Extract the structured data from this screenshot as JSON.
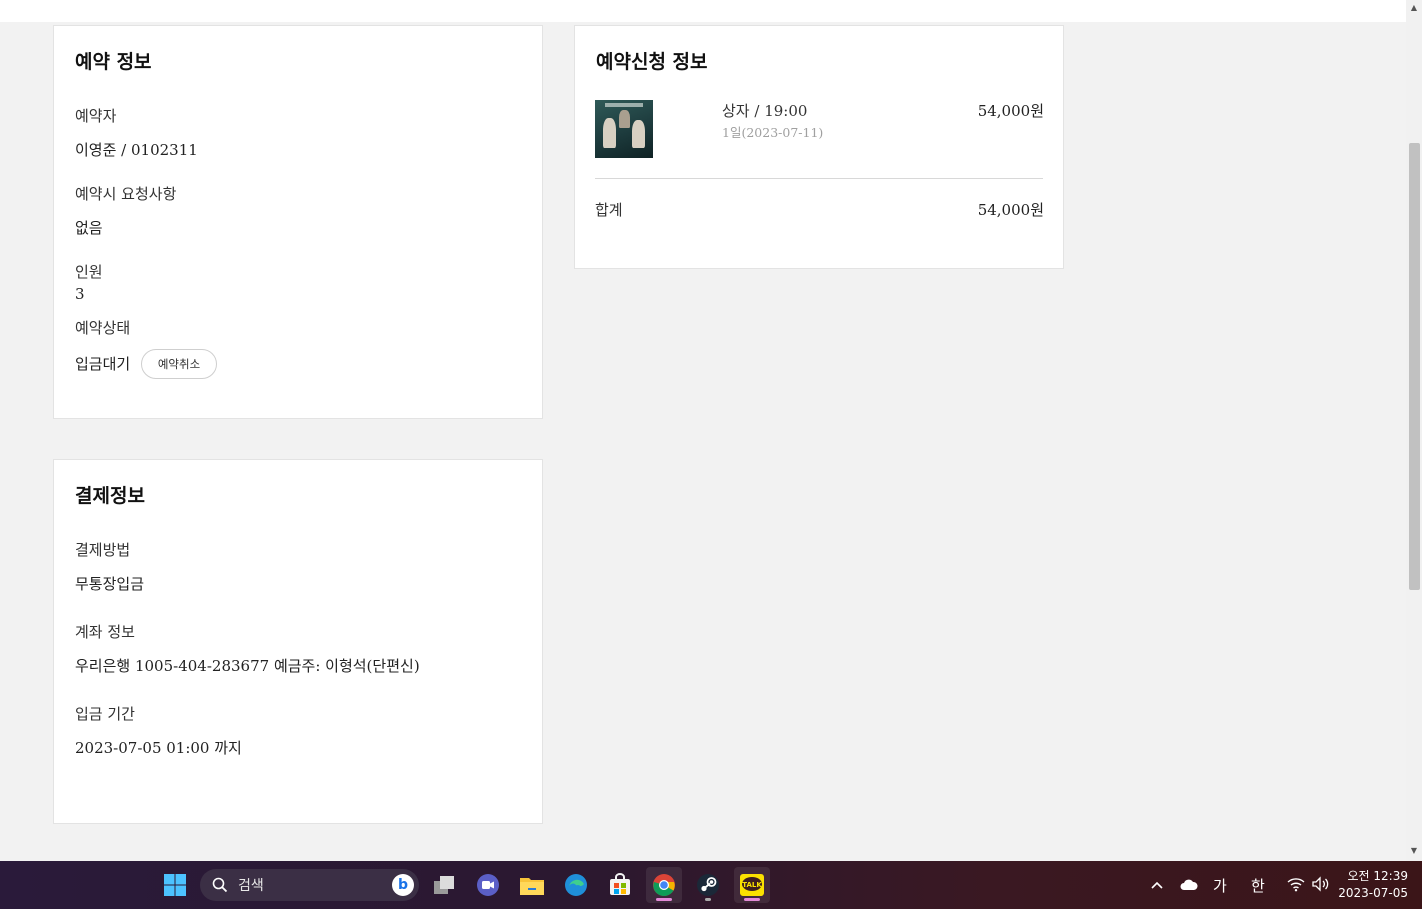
{
  "reservation": {
    "title": "예약 정보",
    "booker_label": "예약자",
    "booker_value": "이영준 / 0102311",
    "request_label": "예약시 요청사항",
    "request_value": "없음",
    "people_label": "인원",
    "people_value": "3",
    "status_label": "예약상태",
    "status_value": "입금대기",
    "cancel_button": "예약취소"
  },
  "request_info": {
    "title": "예약신청 정보",
    "item_name": "상자 / 19:00",
    "item_date": "1일(2023-07-11)",
    "item_price": "54,000원",
    "total_label": "합계",
    "total_value": "54,000원"
  },
  "payment": {
    "title": "결제정보",
    "method_label": "결제방법",
    "method_value": "무통장입금",
    "account_label": "계좌 정보",
    "account_value": "우리은행 1005-404-283677 예금주: 이형석(단편신)",
    "deadline_label": "입금 기간",
    "deadline_value": "2023-07-05 01:00 까지"
  },
  "taskbar": {
    "search_placeholder": "검색",
    "pinned_apps": [
      "start-icon",
      "task-view-icon",
      "chat-icon",
      "file-explorer-icon",
      "edge-icon",
      "store-icon",
      "chrome-icon",
      "steam-icon",
      "kakaotalk-icon"
    ],
    "kakaotalk_label": "TALK",
    "ime_mode": "가",
    "ime_lang": "한",
    "time": "오전 12:39",
    "date": "2023-07-05"
  }
}
